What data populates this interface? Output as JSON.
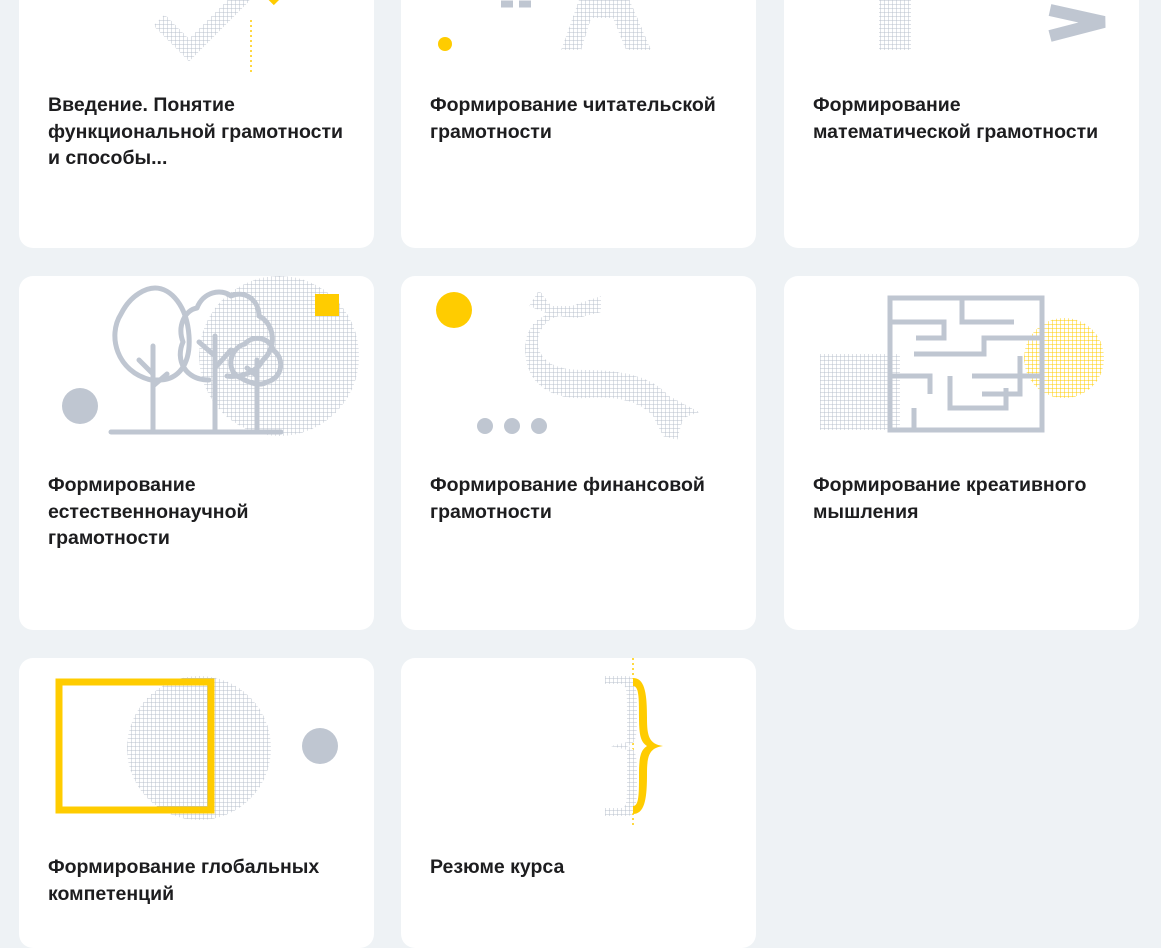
{
  "colors": {
    "background": "#eef2f5",
    "card": "#ffffff",
    "accent": "#ffcc00",
    "icon_gray": "#bfc6d1"
  },
  "courses": [
    {
      "title": "Введение. Понятие функциональной грамотности и способы...",
      "icon": "checkmark-illustration-icon"
    },
    {
      "title": "Формирование читательской грамотности",
      "icon": "letters-illustration-icon"
    },
    {
      "title": "Формирование математической грамотности",
      "icon": "math-symbols-illustration-icon"
    },
    {
      "title": "Формирование естественнонаучной грамотности",
      "icon": "trees-illustration-icon"
    },
    {
      "title": "Формирование финансовой грамотности",
      "icon": "currency-illustration-icon"
    },
    {
      "title": "Формирование креативного мышления",
      "icon": "maze-illustration-icon"
    },
    {
      "title": "Формирование глобальных компетенций",
      "icon": "square-circle-illustration-icon"
    },
    {
      "title": "Резюме курса",
      "icon": "brace-illustration-icon"
    }
  ]
}
